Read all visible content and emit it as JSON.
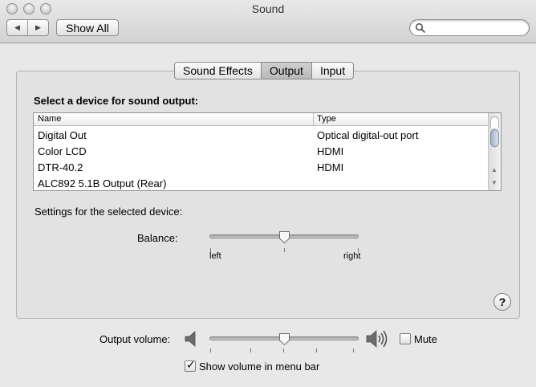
{
  "window": {
    "title": "Sound",
    "show_all_label": "Show All",
    "search_placeholder": ""
  },
  "tabs": [
    {
      "label": "Sound Effects",
      "selected": false
    },
    {
      "label": "Output",
      "selected": true
    },
    {
      "label": "Input",
      "selected": false
    }
  ],
  "output": {
    "heading": "Select a device for sound output:",
    "columns": {
      "name": "Name",
      "type": "Type"
    },
    "devices": [
      {
        "name": "Digital Out",
        "type": "Optical digital-out port"
      },
      {
        "name": "Color LCD",
        "type": "HDMI"
      },
      {
        "name": "DTR-40.2",
        "type": "HDMI"
      },
      {
        "name": "ALC892 5.1B Output (Rear)",
        "type": ""
      }
    ],
    "settings_label": "Settings for the selected device:",
    "balance": {
      "label": "Balance:",
      "left_label": "left",
      "right_label": "right",
      "value": 0.5
    }
  },
  "volume": {
    "label": "Output volume:",
    "value": 0.5,
    "mute_label": "Mute",
    "mute_checked": false,
    "menu_bar_label": "Show volume in menu bar",
    "menu_bar_checked": true
  },
  "icons": {
    "back": "chevron-left",
    "forward": "chevron-right",
    "search": "magnifier",
    "help": "question-mark",
    "volume_low": "speaker-low",
    "volume_high": "speaker-high"
  }
}
